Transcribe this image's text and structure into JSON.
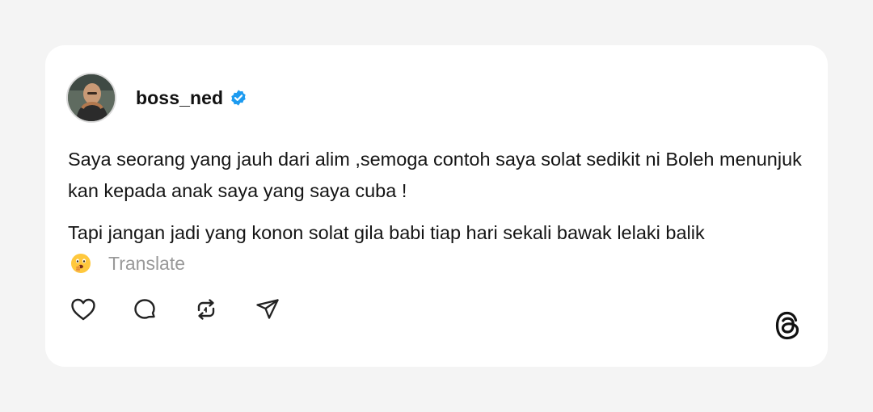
{
  "post": {
    "username": "boss_ned",
    "verified": true,
    "paragraphs": [
      "Saya seorang yang jauh dari alim ,semoga contoh saya solat sedikit ni Boleh menunjuk kan kepada anak saya yang saya cuba !",
      "Tapi jangan jadi yang konon solat gila babi tiap hari sekali bawak lelaki balik"
    ],
    "emoji": "🫢",
    "translate_label": "Translate"
  },
  "icons": {
    "avatar": "avatar-photo",
    "verified": "verified-badge-icon",
    "like": "heart-icon",
    "reply": "comment-icon",
    "repost": "repost-icon",
    "share": "send-icon",
    "logo": "threads-logo-icon"
  },
  "colors": {
    "background": "#f4f4f4",
    "card": "#ffffff",
    "verified": "#1d9bf0",
    "muted": "#999999"
  }
}
